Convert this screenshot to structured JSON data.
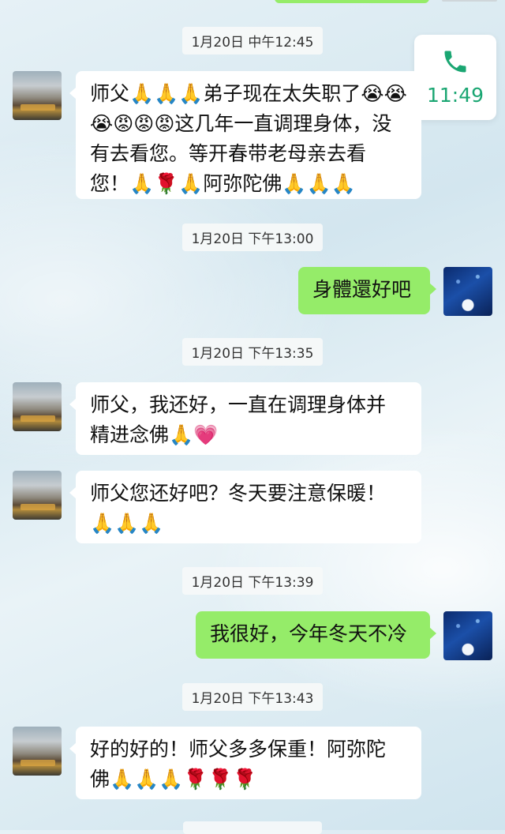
{
  "timestamps": {
    "t1": "1月20日 中午12:45",
    "t2": "1月20日 下午13:00",
    "t3": "1月20日 下午13:35",
    "t4": "1月20日 下午13:39",
    "t5": "1月20日 下午13:43"
  },
  "call_widget": {
    "time": "11:49",
    "icon": "phone-icon",
    "color": "#1aa672"
  },
  "messages": [
    {
      "side": "left",
      "lines": [
        "师父🙏🙏🙏弟子现在太失职了😭😭",
        "😭😡😡😡这几年一直调理身体，没",
        "有去看您。等开春带老母亲去看",
        "您！🙏🌹🙏阿弥陀佛🙏🙏🙏"
      ]
    },
    {
      "side": "right",
      "lines": [
        "身體還好吧"
      ]
    },
    {
      "side": "left",
      "lines": [
        "师父，我还好，一直在调理身体并",
        "精进念佛🙏💗"
      ]
    },
    {
      "side": "left",
      "lines": [
        "师父您还好吧？冬天要注意保暖！",
        "🙏🙏🙏"
      ]
    },
    {
      "side": "right",
      "lines": [
        "我很好，今年冬天不冷"
      ]
    },
    {
      "side": "left",
      "lines": [
        "好的好的！师父多多保重！阿弥陀",
        "佛🙏🙏🙏🌹🌹🌹"
      ]
    }
  ],
  "colors": {
    "sent_bubble": "#95ec69",
    "received_bubble": "#ffffff"
  }
}
